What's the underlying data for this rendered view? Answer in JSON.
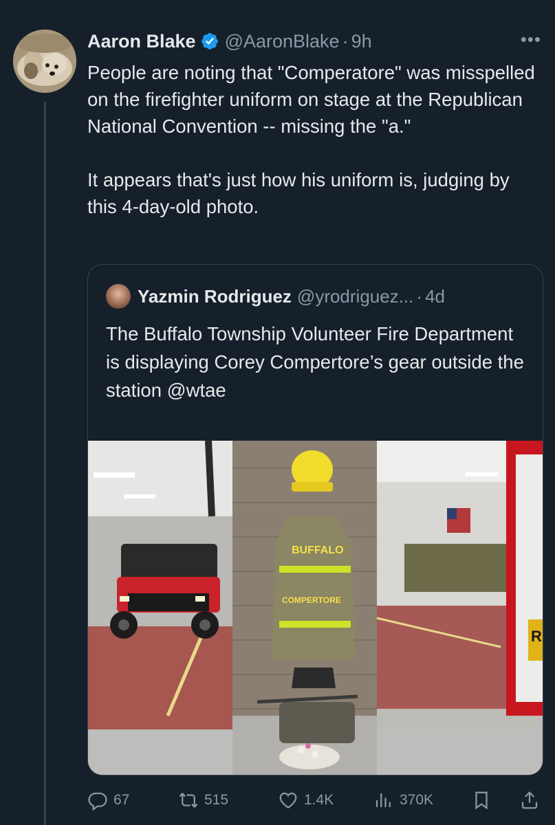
{
  "tweet": {
    "author": {
      "name": "Aaron Blake",
      "handle": "@AaronBlake",
      "separator": "·",
      "time": "9h",
      "verified": true
    },
    "more_label": "•••",
    "text": "People are noting that \"Comperatore\" was misspelled on the firefighter uniform on stage at the Republican National Convention -- missing the \"a.\"\n\nIt appears that's just how his uniform is, judging by this 4-day-old photo.",
    "quote": {
      "author": {
        "name": "Yazmin Rodriguez",
        "handle": "@yrodriguez...",
        "separator": "·",
        "time": "4d"
      },
      "text": "The Buffalo Township Volunteer Fire Department is displaying Corey Compertore’s gear outside the station @wtae",
      "photo": {
        "jacket_label": "BUFFALO",
        "name_label": "COMPERTORE",
        "truck_letter": "R"
      }
    },
    "actions": {
      "replies": "67",
      "reposts": "515",
      "likes": "1.4K",
      "views": "370K"
    },
    "icons": [
      "verified-badge-icon",
      "more-icon",
      "reply-icon",
      "repost-icon",
      "like-icon",
      "views-icon",
      "bookmark-icon",
      "share-icon"
    ],
    "colors": {
      "background": "#15202b",
      "text": "#e7e9ea",
      "secondary": "#8b98a5",
      "verified": "#1d9bf0",
      "border": "#38444d"
    }
  }
}
